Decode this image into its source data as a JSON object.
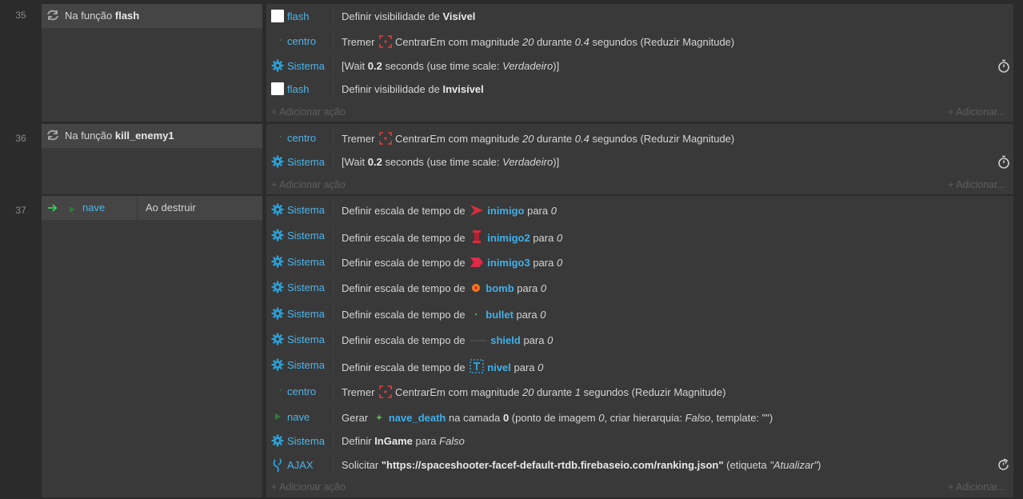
{
  "events": [
    {
      "number": "35",
      "condition": {
        "prefix": "Na função ",
        "name": "flash"
      },
      "actions": [
        {
          "object": "flash",
          "icon": "white-square-icon",
          "parts": [
            {
              "t": "Definir visibilidade de "
            },
            {
              "t": "Visível",
              "s": "b"
            }
          ]
        },
        {
          "object": "centro",
          "icon": "small-dot-icon",
          "parts": [
            {
              "t": "Tremer "
            },
            {
              "t": "",
              "s": "shake"
            },
            {
              "t": "CentrarEm com magnitude "
            },
            {
              "t": "20",
              "s": "i"
            },
            {
              "t": " durante "
            },
            {
              "t": "0.4",
              "s": "i"
            },
            {
              "t": " segundos (Reduzir Magnitude)"
            }
          ]
        },
        {
          "object": "Sistema",
          "icon": "gear-icon",
          "parts": [
            {
              "t": "[Wait "
            },
            {
              "t": "0.2",
              "s": "b"
            },
            {
              "t": " seconds (use time scale: "
            },
            {
              "t": "Verdadeiro",
              "s": "i"
            },
            {
              "t": ")]"
            }
          ],
          "right": "stopwatch-icon"
        },
        {
          "object": "flash",
          "icon": "white-square-icon",
          "parts": [
            {
              "t": "Definir visibilidade de "
            },
            {
              "t": "Invisível",
              "s": "b"
            }
          ]
        }
      ]
    },
    {
      "number": "36",
      "condition": {
        "prefix": "Na função ",
        "name": "kill_enemy1"
      },
      "actions": [
        {
          "object": "centro",
          "icon": "small-dot-icon",
          "parts": [
            {
              "t": "Tremer "
            },
            {
              "t": "",
              "s": "shake"
            },
            {
              "t": "CentrarEm com magnitude "
            },
            {
              "t": "20",
              "s": "i"
            },
            {
              "t": " durante "
            },
            {
              "t": "0.4",
              "s": "i"
            },
            {
              "t": " segundos (Reduzir Magnitude)"
            }
          ]
        },
        {
          "object": "Sistema",
          "icon": "gear-icon",
          "parts": [
            {
              "t": "[Wait "
            },
            {
              "t": "0.2",
              "s": "b"
            },
            {
              "t": " seconds (use time scale: "
            },
            {
              "t": "Verdadeiro",
              "s": "i"
            },
            {
              "t": ")]"
            }
          ],
          "right": "stopwatch-icon"
        }
      ]
    },
    {
      "number": "37",
      "condition": {
        "object": "nave",
        "trigger": "Ao destruir"
      },
      "actions": [
        {
          "object": "Sistema",
          "icon": "gear-icon",
          "parts": [
            {
              "t": "Definir escala de tempo de "
            },
            {
              "t": "inimigo",
              "s": "hl",
              "sprite": "enemy-ship-red"
            },
            {
              "t": " para "
            },
            {
              "t": "0",
              "s": "i"
            }
          ]
        },
        {
          "object": "Sistema",
          "icon": "gear-icon",
          "parts": [
            {
              "t": "Definir escala de tempo de "
            },
            {
              "t": "inimigo2",
              "s": "hl",
              "sprite": "enemy-ship-red2"
            },
            {
              "t": " para "
            },
            {
              "t": "0",
              "s": "i"
            }
          ]
        },
        {
          "object": "Sistema",
          "icon": "gear-icon",
          "parts": [
            {
              "t": "Definir escala de tempo de "
            },
            {
              "t": "inimigo3",
              "s": "hl",
              "sprite": "enemy-ship-red3"
            },
            {
              "t": " para "
            },
            {
              "t": "0",
              "s": "i"
            }
          ]
        },
        {
          "object": "Sistema",
          "icon": "gear-icon",
          "parts": [
            {
              "t": "Definir escala de tempo de "
            },
            {
              "t": "bomb",
              "s": "hl",
              "sprite": "bomb-orange"
            },
            {
              "t": " para "
            },
            {
              "t": "0",
              "s": "i"
            }
          ]
        },
        {
          "object": "Sistema",
          "icon": "gear-icon",
          "parts": [
            {
              "t": "Definir escala de tempo de "
            },
            {
              "t": "bullet",
              "s": "hl",
              "sprite": "bullet-green"
            },
            {
              "t": " para "
            },
            {
              "t": "0",
              "s": "i"
            }
          ]
        },
        {
          "object": "Sistema",
          "icon": "gear-icon",
          "parts": [
            {
              "t": "Definir escala de tempo de "
            },
            {
              "t": "shield",
              "s": "hl",
              "sprite": "shield-line"
            },
            {
              "t": " para "
            },
            {
              "t": "0",
              "s": "i"
            }
          ]
        },
        {
          "object": "Sistema",
          "icon": "gear-icon",
          "parts": [
            {
              "t": "Definir escala de tempo de "
            },
            {
              "t": "nivel",
              "s": "hl",
              "sprite": "tilemap-blue"
            },
            {
              "t": " para "
            },
            {
              "t": "0",
              "s": "i"
            }
          ]
        },
        {
          "object": "centro",
          "icon": "small-dot-icon",
          "parts": [
            {
              "t": "Tremer "
            },
            {
              "t": "",
              "s": "shake"
            },
            {
              "t": "CentrarEm com magnitude "
            },
            {
              "t": "20",
              "s": "i"
            },
            {
              "t": " durante "
            },
            {
              "t": "1",
              "s": "i"
            },
            {
              "t": " segundos (Reduzir Magnitude)"
            }
          ]
        },
        {
          "object": "nave",
          "icon": "nave-sprite-icon",
          "parts": [
            {
              "t": "Gerar "
            },
            {
              "t": "nave_death",
              "s": "hl",
              "sprite": "explosion-green"
            },
            {
              "t": " na camada "
            },
            {
              "t": "0",
              "s": "b"
            },
            {
              "t": " (ponto de imagem "
            },
            {
              "t": "0",
              "s": "i"
            },
            {
              "t": ", criar hierarquia: "
            },
            {
              "t": "Falso",
              "s": "i"
            },
            {
              "t": ", template: \"\")"
            }
          ]
        },
        {
          "object": "Sistema",
          "icon": "gear-icon",
          "parts": [
            {
              "t": "Definir "
            },
            {
              "t": "InGame",
              "s": "b"
            },
            {
              "t": " para "
            },
            {
              "t": "Falso",
              "s": "i"
            }
          ]
        },
        {
          "object": "AJAX",
          "icon": "ajax-icon",
          "parts": [
            {
              "t": "Solicitar "
            },
            {
              "t": "\"https://spaceshooter-facef-default-rtdb.firebaseio.com/ranking.json\"",
              "s": "b"
            },
            {
              "t": " (etiqueta "
            },
            {
              "t": "\"Atualizar\"",
              "s": "i"
            },
            {
              "t": ")"
            }
          ],
          "right": "refresh-icon"
        }
      ]
    }
  ],
  "add_action_label": "Adicionar ação",
  "add_right_label": "Adicionar..."
}
